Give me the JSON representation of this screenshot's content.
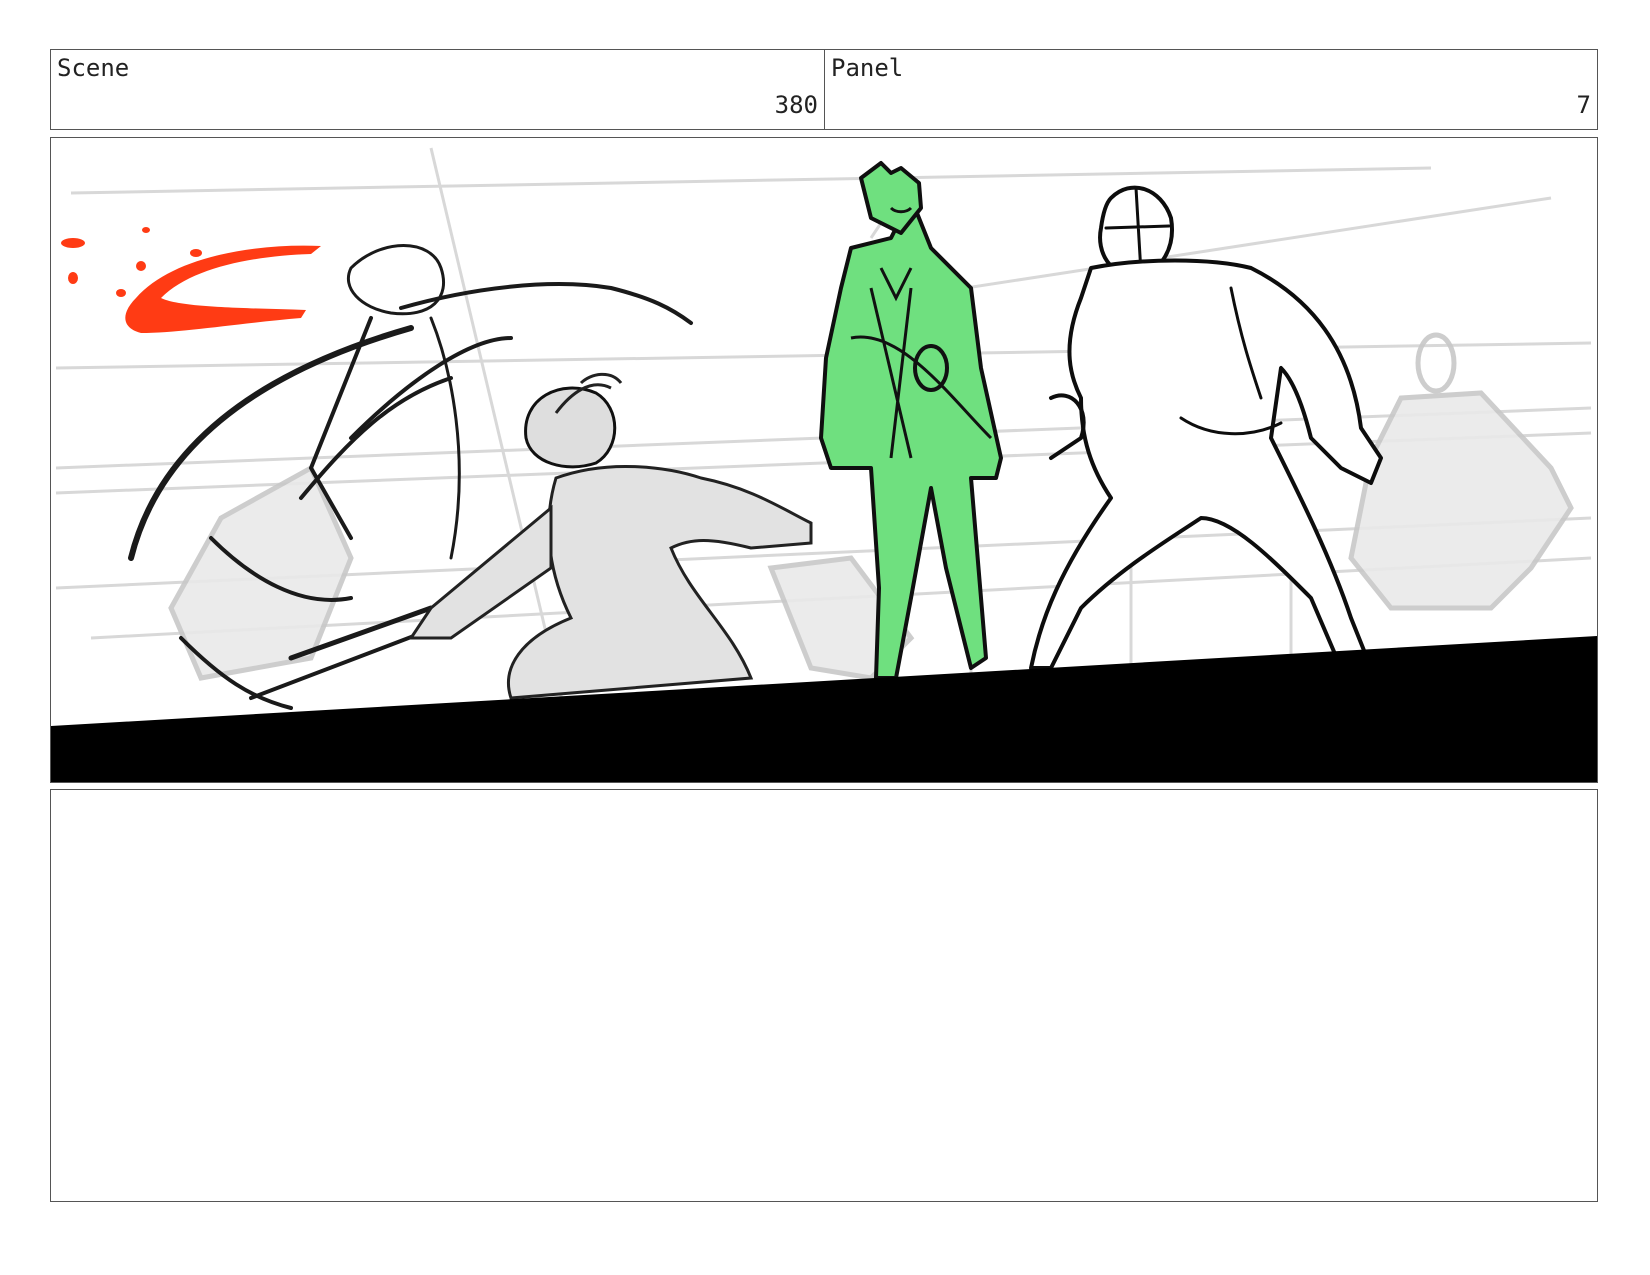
{
  "header": {
    "scene_label": "Scene",
    "scene_number": "380",
    "panel_label": "Panel",
    "panel_number": "7"
  },
  "colors": {
    "highlight_figure": "#6fe07f",
    "blood_splatter": "#ff3b14",
    "ink": "#111111",
    "ground": "#000000"
  },
  "notes": {
    "text": ""
  }
}
